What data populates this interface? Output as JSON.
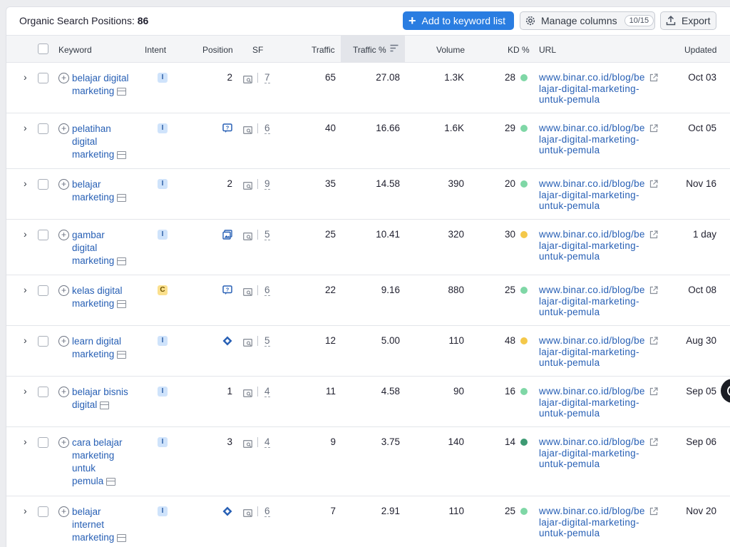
{
  "header": {
    "title_label": "Organic Search Positions:",
    "title_count": "86",
    "add_button": "Add to keyword list",
    "manage_button": "Manage columns",
    "manage_count": "10/15",
    "export_button": "Export"
  },
  "columns": {
    "keyword": "Keyword",
    "intent": "Intent",
    "position": "Position",
    "sf": "SF",
    "traffic": "Traffic",
    "traffic_pct": "Traffic %",
    "volume": "Volume",
    "kd": "KD %",
    "url": "URL",
    "updated": "Updated"
  },
  "colors": {
    "kd_green": "#7fd7a6",
    "kd_yellow": "#f4c84a",
    "kd_dark_green": "#3d9a73",
    "link": "#2860b5",
    "primary": "#2a7de1"
  },
  "rows": [
    {
      "keyword_lines": [
        "belajar digital",
        "marketing"
      ],
      "intent": "I",
      "feature": "",
      "position": "2",
      "sf": "7",
      "traffic": "65",
      "traffic_pct": "27.08",
      "volume": "1.3K",
      "kd": "28",
      "kd_color": "green",
      "url_lines": [
        "www.binar.co.id/blog/be",
        "lajar-digital-marketing-",
        "untuk-pemula"
      ],
      "updated": "Oct 03"
    },
    {
      "keyword_lines": [
        "pelatihan",
        "digital",
        "marketing"
      ],
      "intent": "I",
      "feature": "faq-icon",
      "position": "",
      "sf": "6",
      "traffic": "40",
      "traffic_pct": "16.66",
      "volume": "1.6K",
      "kd": "29",
      "kd_color": "green",
      "url_lines": [
        "www.binar.co.id/blog/be",
        "lajar-digital-marketing-",
        "untuk-pemula"
      ],
      "updated": "Oct 05"
    },
    {
      "keyword_lines": [
        "belajar",
        "marketing"
      ],
      "intent": "I",
      "feature": "",
      "position": "2",
      "sf": "9",
      "traffic": "35",
      "traffic_pct": "14.58",
      "volume": "390",
      "kd": "20",
      "kd_color": "green",
      "url_lines": [
        "www.binar.co.id/blog/be",
        "lajar-digital-marketing-",
        "untuk-pemula"
      ],
      "updated": "Nov 16"
    },
    {
      "keyword_lines": [
        "gambar",
        "digital",
        "marketing"
      ],
      "intent": "I",
      "feature": "image-icon",
      "position": "",
      "sf": "5",
      "traffic": "25",
      "traffic_pct": "10.41",
      "volume": "320",
      "kd": "30",
      "kd_color": "yellow",
      "url_lines": [
        "www.binar.co.id/blog/be",
        "lajar-digital-marketing-",
        "untuk-pemula"
      ],
      "updated": "1 day"
    },
    {
      "keyword_lines": [
        "kelas digital",
        "marketing"
      ],
      "intent": "C",
      "feature": "faq-icon",
      "position": "",
      "sf": "6",
      "traffic": "22",
      "traffic_pct": "9.16",
      "volume": "880",
      "kd": "25",
      "kd_color": "green",
      "url_lines": [
        "www.binar.co.id/blog/be",
        "lajar-digital-marketing-",
        "untuk-pemula"
      ],
      "updated": "Oct 08"
    },
    {
      "keyword_lines": [
        "learn digital",
        "marketing"
      ],
      "intent": "I",
      "feature": "diamond-icon",
      "position": "",
      "sf": "5",
      "traffic": "12",
      "traffic_pct": "5.00",
      "volume": "110",
      "kd": "48",
      "kd_color": "yellow",
      "url_lines": [
        "www.binar.co.id/blog/be",
        "lajar-digital-marketing-",
        "untuk-pemula"
      ],
      "updated": "Aug 30"
    },
    {
      "keyword_lines": [
        "belajar bisnis",
        "digital"
      ],
      "intent": "I",
      "feature": "",
      "position": "1",
      "sf": "4",
      "traffic": "11",
      "traffic_pct": "4.58",
      "volume": "90",
      "kd": "16",
      "kd_color": "green",
      "url_lines": [
        "www.binar.co.id/blog/be",
        "lajar-digital-marketing-",
        "untuk-pemula"
      ],
      "updated": "Sep 05"
    },
    {
      "keyword_lines": [
        "cara belajar",
        "marketing",
        "untuk",
        "pemula"
      ],
      "intent": "I",
      "feature": "",
      "position": "3",
      "sf": "4",
      "traffic": "9",
      "traffic_pct": "3.75",
      "volume": "140",
      "kd": "14",
      "kd_color": "dark_green",
      "url_lines": [
        "www.binar.co.id/blog/be",
        "lajar-digital-marketing-",
        "untuk-pemula"
      ],
      "updated": "Sep 06"
    },
    {
      "keyword_lines": [
        "belajar",
        "internet",
        "marketing"
      ],
      "intent": "I",
      "feature": "diamond-icon",
      "position": "",
      "sf": "6",
      "traffic": "7",
      "traffic_pct": "2.91",
      "volume": "110",
      "kd": "25",
      "kd_color": "green",
      "url_lines": [
        "www.binar.co.id/blog/be",
        "lajar-digital-marketing-",
        "untuk-pemula"
      ],
      "updated": "Nov 20"
    }
  ]
}
